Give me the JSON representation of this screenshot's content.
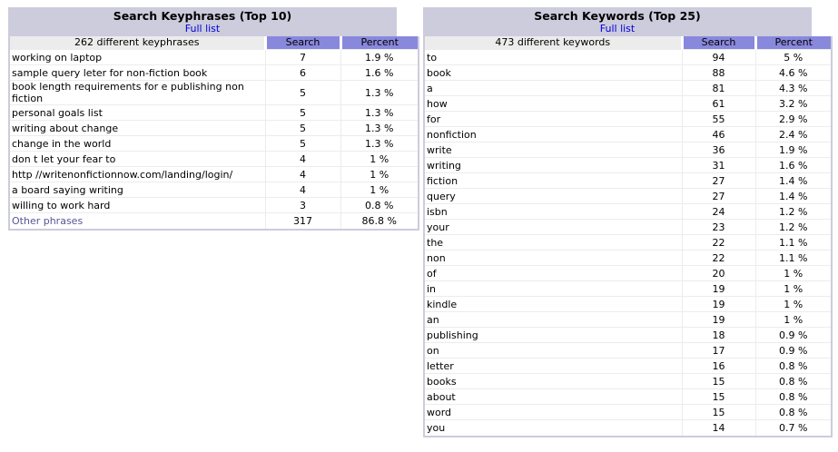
{
  "keyphrases": {
    "title": "Search Keyphrases (Top 10)",
    "full_list": "Full list",
    "caption": "262 different keyphrases",
    "col_search": "Search",
    "col_percent": "Percent",
    "rows": [
      {
        "phrase": "working on laptop",
        "search": "7",
        "percent": "1.9 %"
      },
      {
        "phrase": "sample query leter for non-fiction book",
        "search": "6",
        "percent": "1.6 %"
      },
      {
        "phrase": "book length requirements for e publishing non fiction",
        "search": "5",
        "percent": "1.3 %"
      },
      {
        "phrase": "personal goals list",
        "search": "5",
        "percent": "1.3 %"
      },
      {
        "phrase": "writing about change",
        "search": "5",
        "percent": "1.3 %"
      },
      {
        "phrase": "change in the world",
        "search": "5",
        "percent": "1.3 %"
      },
      {
        "phrase": "don t let your fear to",
        "search": "4",
        "percent": "1 %"
      },
      {
        "phrase": "http //writenonfictionnow.com/landing/login/",
        "search": "4",
        "percent": "1 %"
      },
      {
        "phrase": "a board saying writing",
        "search": "4",
        "percent": "1 %"
      },
      {
        "phrase": "willing to work hard",
        "search": "3",
        "percent": "0.8 %"
      }
    ],
    "other": {
      "phrase": "Other phrases",
      "search": "317",
      "percent": "86.8 %"
    }
  },
  "keywords": {
    "title": "Search Keywords (Top 25)",
    "full_list": "Full list",
    "caption": "473 different keywords",
    "col_search": "Search",
    "col_percent": "Percent",
    "rows": [
      {
        "word": "to",
        "search": "94",
        "percent": "5 %"
      },
      {
        "word": "book",
        "search": "88",
        "percent": "4.6 %"
      },
      {
        "word": "a",
        "search": "81",
        "percent": "4.3 %"
      },
      {
        "word": "how",
        "search": "61",
        "percent": "3.2 %"
      },
      {
        "word": "for",
        "search": "55",
        "percent": "2.9 %"
      },
      {
        "word": "nonfiction",
        "search": "46",
        "percent": "2.4 %"
      },
      {
        "word": "write",
        "search": "36",
        "percent": "1.9 %"
      },
      {
        "word": "writing",
        "search": "31",
        "percent": "1.6 %"
      },
      {
        "word": "fiction",
        "search": "27",
        "percent": "1.4 %"
      },
      {
        "word": "query",
        "search": "27",
        "percent": "1.4 %"
      },
      {
        "word": "isbn",
        "search": "24",
        "percent": "1.2 %"
      },
      {
        "word": "your",
        "search": "23",
        "percent": "1.2 %"
      },
      {
        "word": "the",
        "search": "22",
        "percent": "1.1 %"
      },
      {
        "word": "non",
        "search": "22",
        "percent": "1.1 %"
      },
      {
        "word": "of",
        "search": "20",
        "percent": "1 %"
      },
      {
        "word": "in",
        "search": "19",
        "percent": "1 %"
      },
      {
        "word": "kindle",
        "search": "19",
        "percent": "1 %"
      },
      {
        "word": "an",
        "search": "19",
        "percent": "1 %"
      },
      {
        "word": "publishing",
        "search": "18",
        "percent": "0.9 %"
      },
      {
        "word": "on",
        "search": "17",
        "percent": "0.9 %"
      },
      {
        "word": "letter",
        "search": "16",
        "percent": "0.8 %"
      },
      {
        "word": "books",
        "search": "15",
        "percent": "0.8 %"
      },
      {
        "word": "about",
        "search": "15",
        "percent": "0.8 %"
      },
      {
        "word": "word",
        "search": "15",
        "percent": "0.8 %"
      },
      {
        "word": "you",
        "search": "14",
        "percent": "0.7 %"
      }
    ]
  }
}
